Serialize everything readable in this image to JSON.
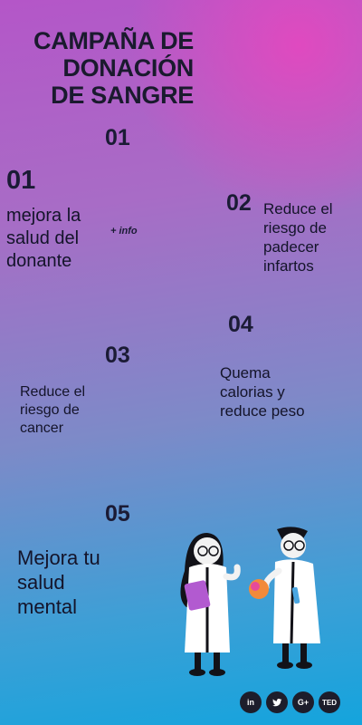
{
  "title": {
    "line1": "CAMPAÑA DE",
    "line2": "DONACIÓN",
    "line3": "DE SANGRE"
  },
  "items": [
    {
      "number": "01",
      "text_line1": "mejora la",
      "text_line2": "salud del",
      "text_line3": "donante"
    },
    {
      "number": "02",
      "text_line1": "Reduce el",
      "text_line2": "riesgo de",
      "text_line3": "padecer",
      "text_line4": "infartos"
    },
    {
      "number": "03",
      "text_line1": "Reduce el",
      "text_line2": "riesgo de",
      "text_line3": "cancer"
    },
    {
      "number": "04",
      "text_line1": "Quema",
      "text_line2": "calorias y",
      "text_line3": "reduce peso"
    },
    {
      "number": "05",
      "text_line1": "Mejora tu",
      "text_line2": "salud",
      "text_line3": "mental"
    }
  ],
  "header_number": "01",
  "info_link": "+ info",
  "social": {
    "linkedin": "in",
    "twitter": "",
    "google": "G+",
    "ted": "TED"
  },
  "colors": {
    "top": "#b456c8",
    "pink": "#e846be",
    "bottom": "#14a4dd",
    "text": "#1a1a2e"
  }
}
